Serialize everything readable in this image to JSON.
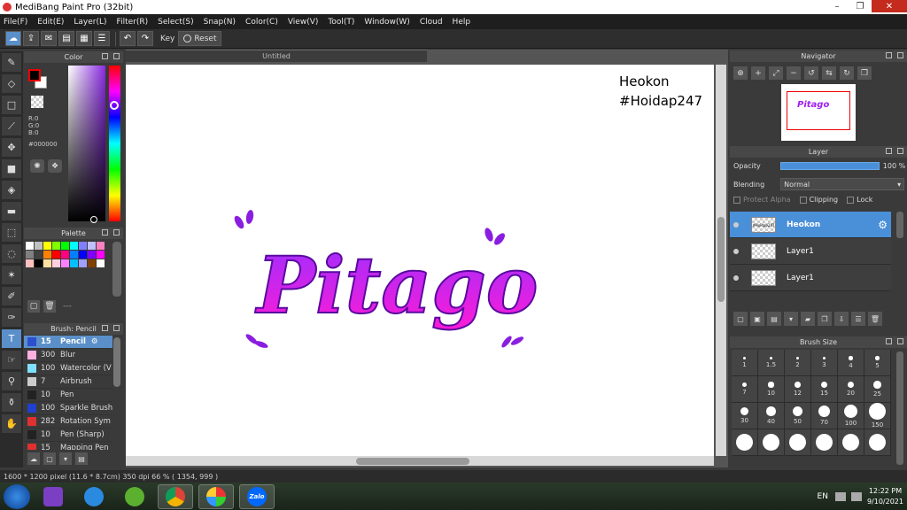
{
  "window": {
    "title": "MediBang Paint Pro (32bit)",
    "controls": [
      "–",
      "❐",
      "✕"
    ]
  },
  "menu": [
    "File(F)",
    "Edit(E)",
    "Layer(L)",
    "Filter(R)",
    "Select(S)",
    "Snap(N)",
    "Color(C)",
    "View(V)",
    "Tool(T)",
    "Window(W)",
    "Cloud",
    "Help"
  ],
  "toolbar": {
    "key_label": "Key",
    "reset_label": "Reset"
  },
  "color_panel": {
    "title": "Color",
    "r": "R:0",
    "g": "G:0",
    "b": "B:0",
    "hex": "#000000"
  },
  "palette_panel": {
    "title": "Palette",
    "dash": "---",
    "colors": [
      "#ffffff",
      "#c0c0c0",
      "#ffff00",
      "#80ff00",
      "#00ff00",
      "#00ffff",
      "#8080ff",
      "#c0c0ff",
      "#ff80c0",
      "#808080",
      "#404040",
      "#ff8000",
      "#ff0000",
      "#ff0080",
      "#0080ff",
      "#0000ff",
      "#8000ff",
      "#ff00ff",
      "#ffc0c0",
      "#000000",
      "#ffe0a0",
      "#ffd0e0",
      "#ff80ff",
      "#00c0ff",
      "#a0a0ff",
      "#804000",
      "#ffffff"
    ]
  },
  "brush_panel": {
    "title": "Brush: Pencil",
    "brushes": [
      {
        "size": "15",
        "name": "Pencil",
        "color": "#2d4fcf",
        "active": true
      },
      {
        "size": "300",
        "name": "Blur",
        "color": "#ffb0e0"
      },
      {
        "size": "100",
        "name": "Watercolor (V",
        "color": "#80e0ff"
      },
      {
        "size": "7",
        "name": "Airbrush",
        "color": "#cccccc"
      },
      {
        "size": "10",
        "name": "Pen",
        "color": "#222222"
      },
      {
        "size": "100",
        "name": "Sparkle Brush",
        "color": "#2040d0"
      },
      {
        "size": "282",
        "name": "Rotation Sym",
        "color": "#e03030"
      },
      {
        "size": "10",
        "name": "Pen (Sharp)",
        "color": "#222222"
      },
      {
        "size": "15",
        "name": "Mapping Pen",
        "color": "#e03030"
      }
    ]
  },
  "canvas": {
    "tab": "Untitled",
    "watermark_line1": "Heokon",
    "watermark_line2": "#Hoidap247",
    "artwork_text": "Pitago"
  },
  "navigator": {
    "title": "Navigator",
    "mini_text": "Pitago"
  },
  "layer_panel": {
    "title": "Layer",
    "opacity_label": "Opacity",
    "opacity_value": "100 %",
    "opacity_level": 1.0,
    "blending_label": "Blending",
    "blending_value": "Normal",
    "protect_alpha": "Protect Alpha",
    "clipping": "Clipping",
    "lock": "Lock",
    "layers": [
      {
        "name": "Heokon",
        "active": true,
        "thumb": "#Hoidap247"
      },
      {
        "name": "Layer1",
        "active": false
      },
      {
        "name": "Layer1",
        "active": false
      }
    ]
  },
  "brush_size_panel": {
    "title": "Brush Size",
    "sizes": [
      "1",
      "1.5",
      "2",
      "3",
      "4",
      "5",
      "7",
      "10",
      "12",
      "15",
      "20",
      "25",
      "30",
      "40",
      "50",
      "70",
      "100",
      "150"
    ]
  },
  "status": {
    "text": "1600 * 1200 pixel   (11.6 * 8.7cm)   350 dpi   66 %   ( 1354, 999 )"
  },
  "taskbar": {
    "lang": "EN",
    "time": "12:22 PM",
    "date": "9/10/2021",
    "zalo": "Zalo"
  }
}
